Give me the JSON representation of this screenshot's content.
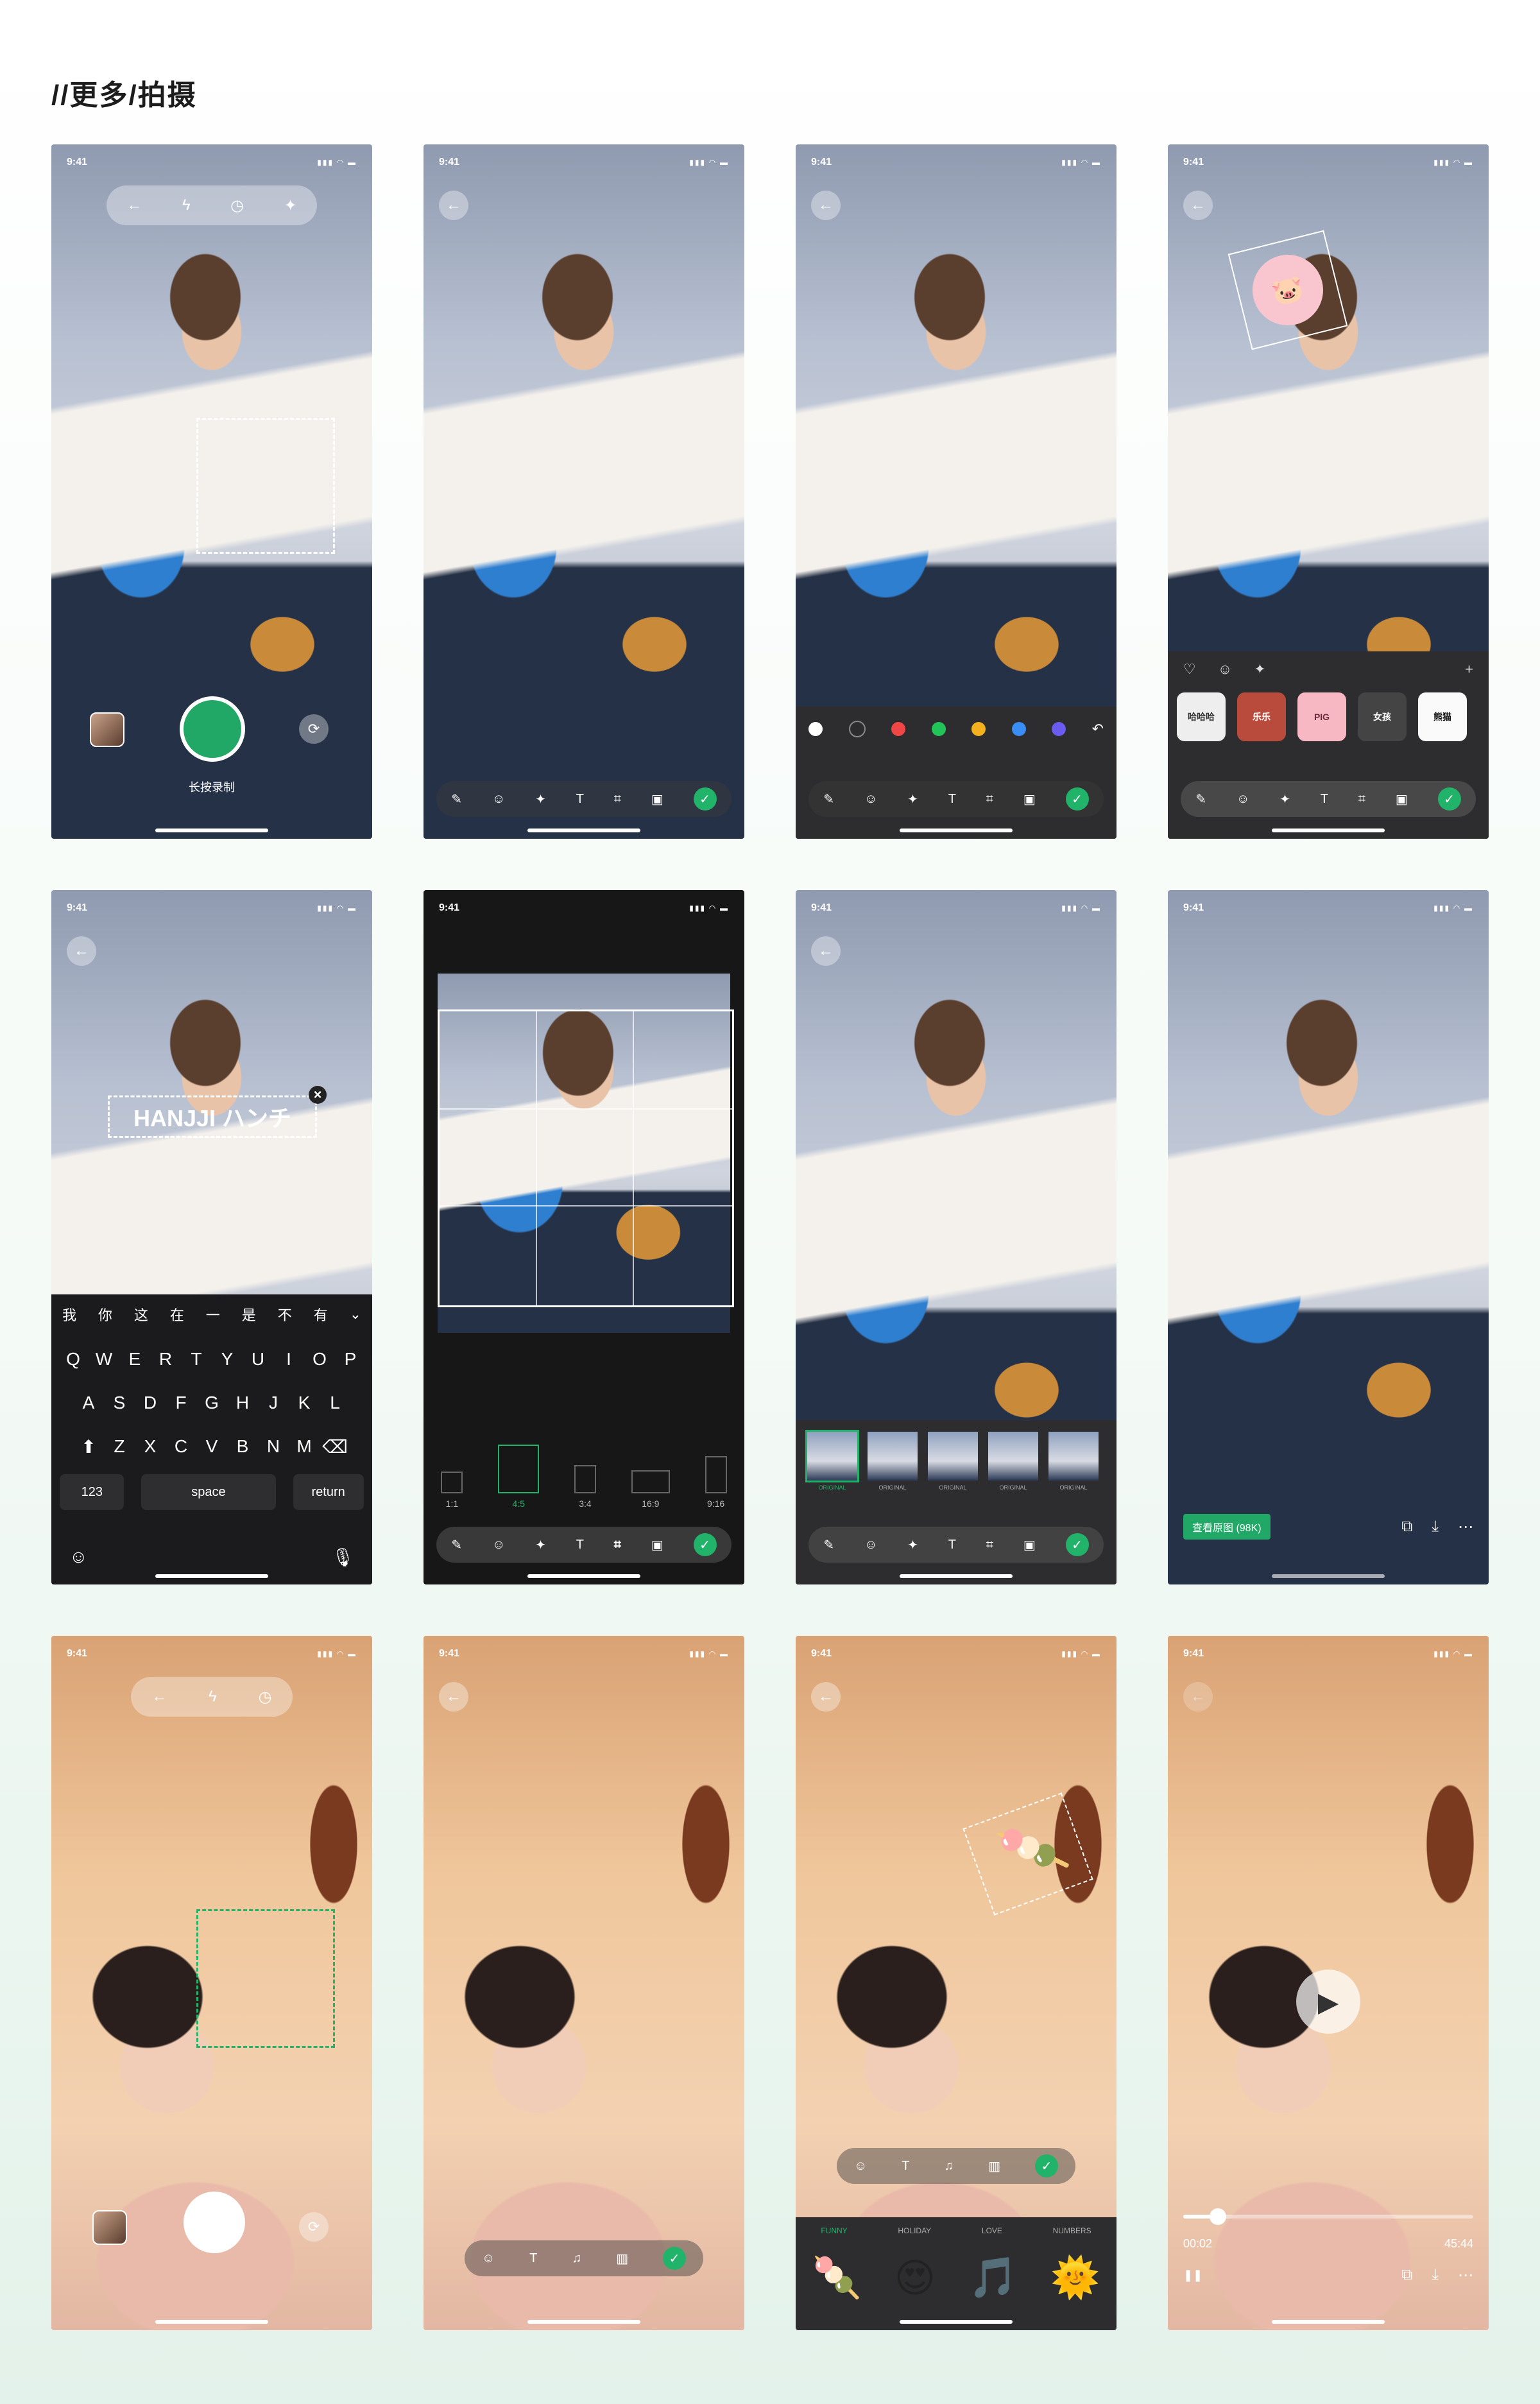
{
  "page": {
    "title": "//更多/拍摄"
  },
  "status": {
    "time": "9:41",
    "indicators": "▮▮▮ ◠ ▬"
  },
  "icons": {
    "back": "←",
    "flash": "ϟ",
    "timer": "◷",
    "magic": "✦",
    "flip": "⟳",
    "check": "✓",
    "plus": "+",
    "close": "×",
    "pen": "✎",
    "emoji": "☺",
    "text": "T",
    "crop": "⌗",
    "frame": "▣",
    "music": "♫",
    "film": "▥",
    "undo": "↶",
    "heart": "♡",
    "play": "▶",
    "pause": "❚❚",
    "copy": "⧉",
    "download": "⤓",
    "more": "⋯",
    "shift": "⬆",
    "delete": "⌫",
    "chevron": "⌄",
    "mic": "🎙"
  },
  "accent": "#22b36a",
  "screens": {
    "s1": {
      "hint": "长按录制"
    },
    "s3": {
      "colors": [
        "#ffffff",
        "#2d2d2f",
        "#f04646",
        "#22c45a",
        "#f5b020",
        "#3a8df5",
        "#6b5cf0"
      ]
    },
    "s4": {
      "stickers": [
        "哈哈哈",
        "乐乐",
        "PIG",
        "女孩",
        "熊猫"
      ]
    },
    "s5": {
      "text_overlay": "HANJJI ハンチ",
      "candidates": [
        "我",
        "你",
        "这",
        "在",
        "一",
        "是",
        "不",
        "有"
      ],
      "rows": [
        [
          "Q",
          "W",
          "E",
          "R",
          "T",
          "Y",
          "U",
          "I",
          "O",
          "P"
        ],
        [
          "A",
          "S",
          "D",
          "F",
          "G",
          "H",
          "J",
          "K",
          "L"
        ],
        [
          "Z",
          "X",
          "C",
          "V",
          "B",
          "N",
          "M"
        ]
      ],
      "key_123": "123",
      "key_space": "space",
      "key_return": "return"
    },
    "s6": {
      "ratios": [
        "1:1",
        "4:5",
        "3:4",
        "16:9",
        "9:16"
      ]
    },
    "s7": {
      "filters": [
        "ORIGINAL",
        "ORIGINAL",
        "ORIGINAL",
        "ORIGINAL",
        "ORIGINAL"
      ]
    },
    "s8": {
      "original_btn": "查看原图 (98K)"
    },
    "s11": {
      "tabs": [
        "FUNNY",
        "HOLIDAY",
        "LOVE",
        "NUMBERS"
      ],
      "emojis": [
        "🍡",
        "😍",
        "🎵",
        "🌞"
      ]
    },
    "s12": {
      "current": "00:02",
      "total": "45:44",
      "progress": 0.12
    }
  }
}
